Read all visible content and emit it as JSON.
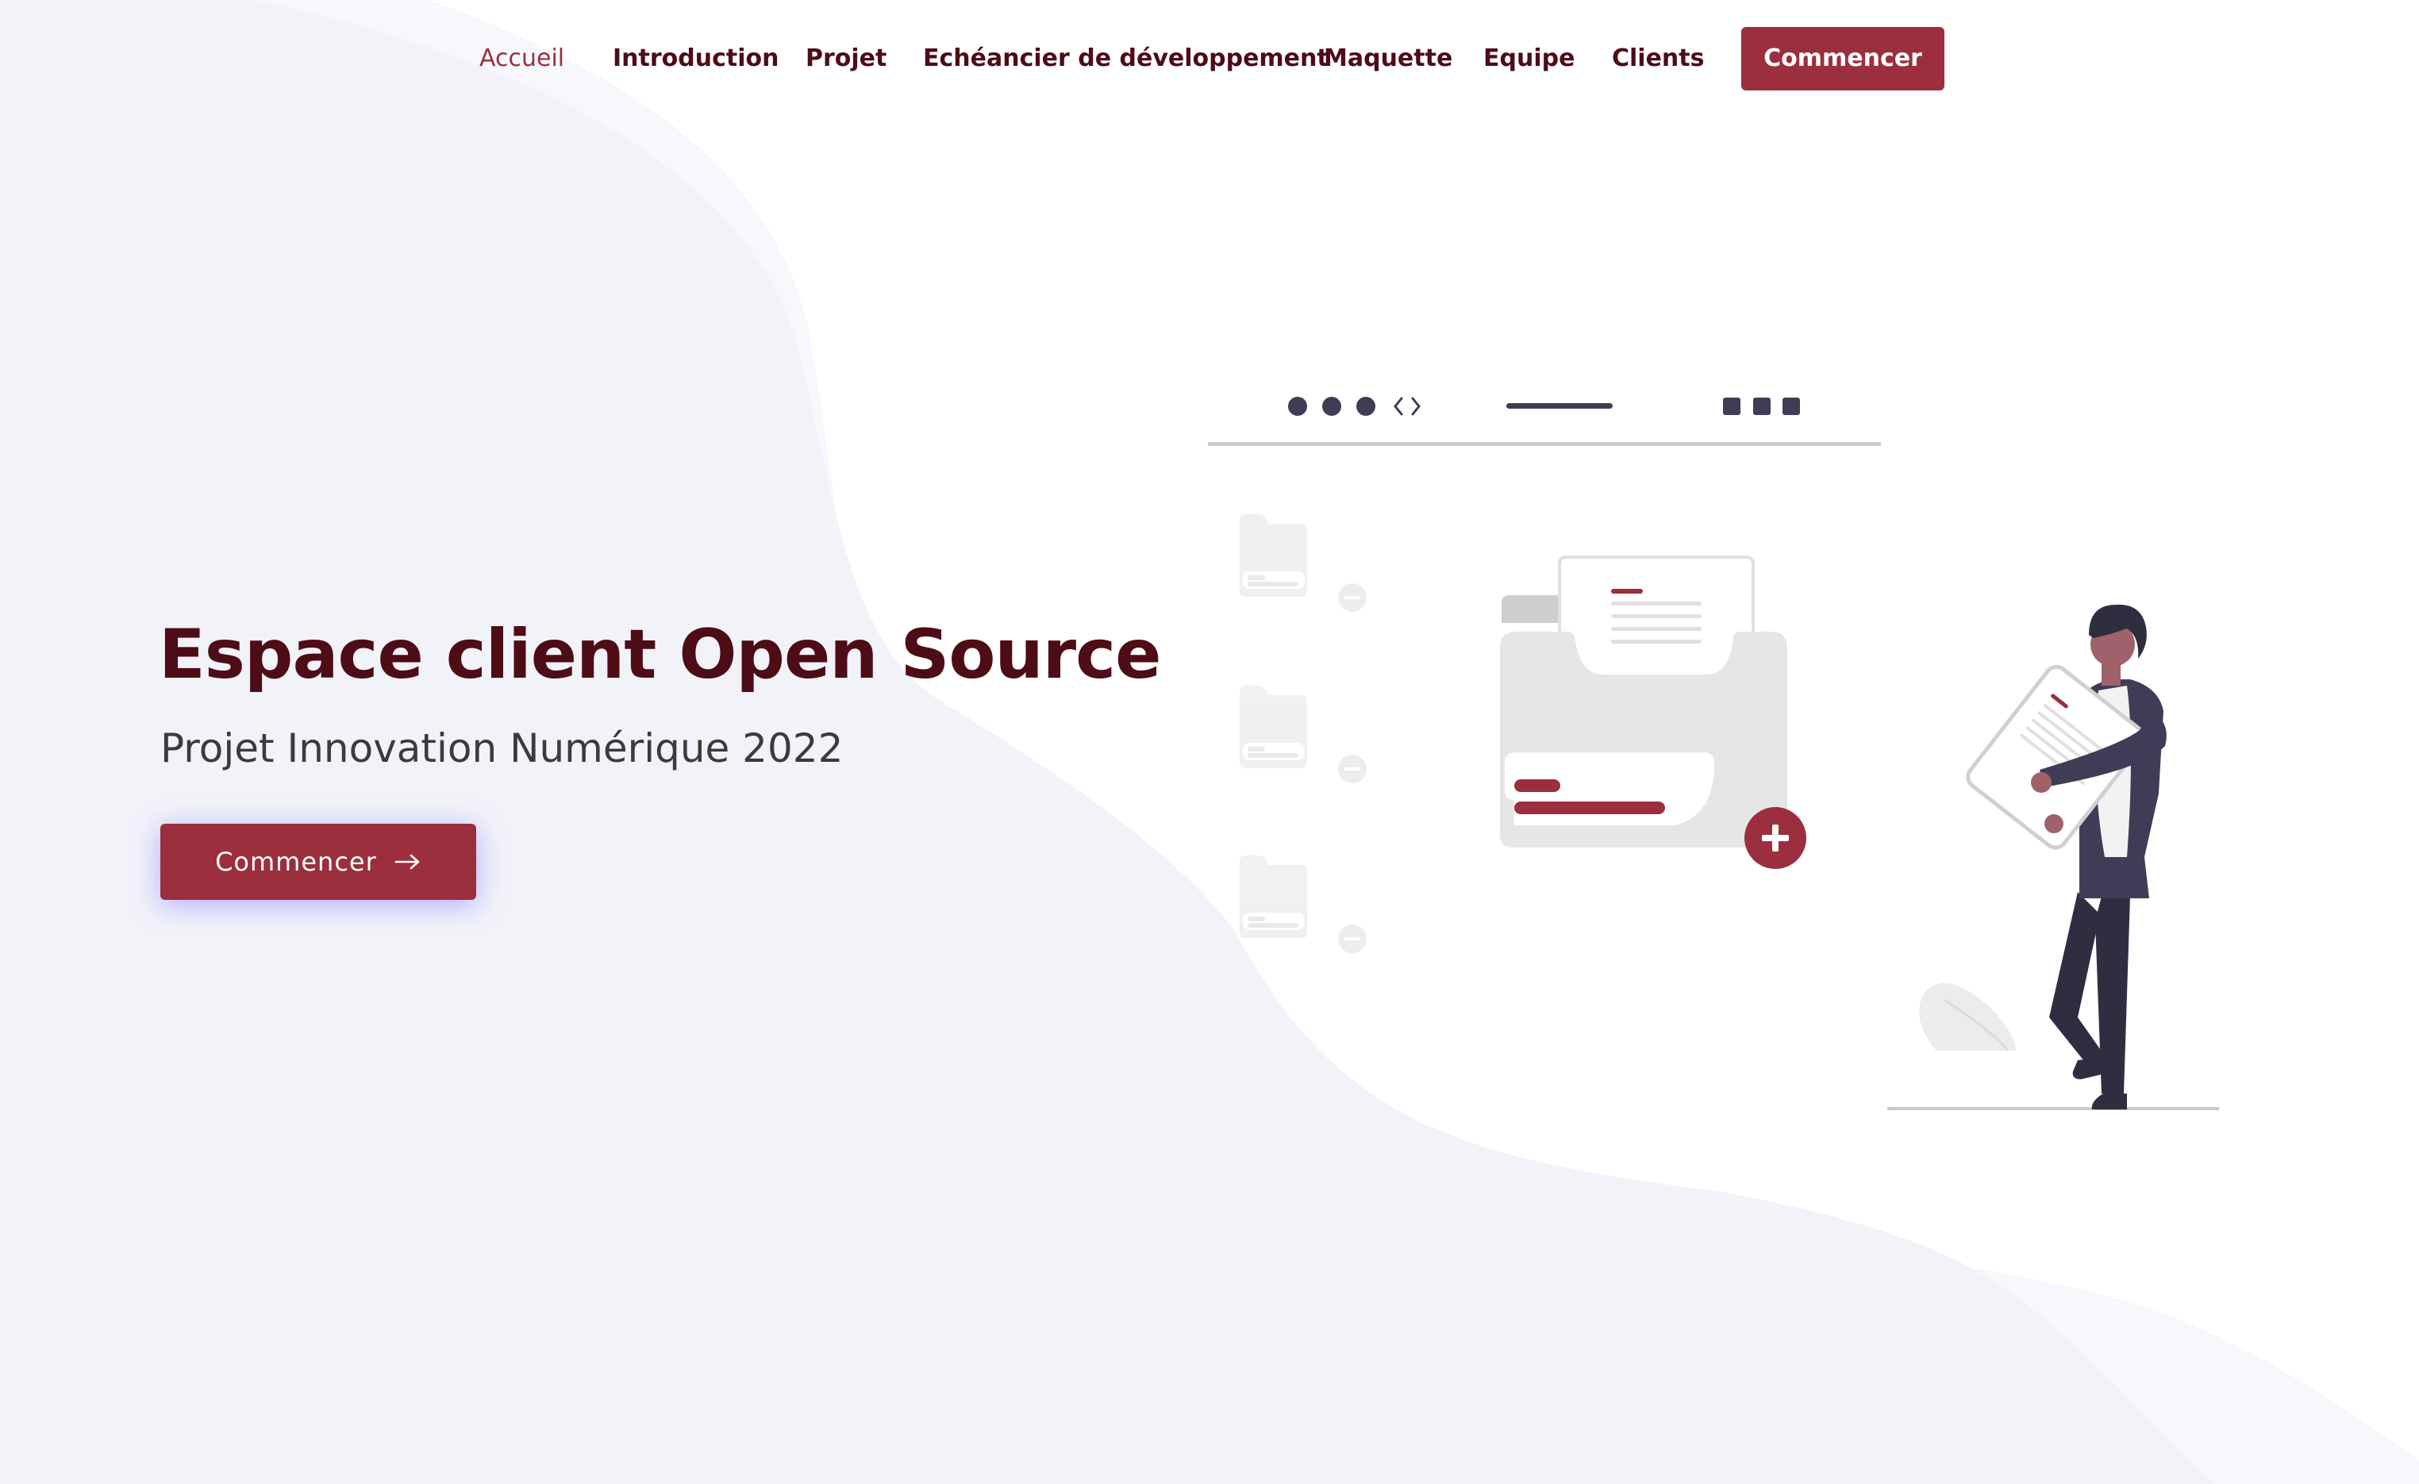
{
  "nav": {
    "items": [
      {
        "label": "Accueil",
        "active": true
      },
      {
        "label": "Introduction",
        "active": false
      },
      {
        "label": "Projet",
        "active": false
      },
      {
        "label": "Echéancier de développement",
        "active": false
      },
      {
        "label": "Maquette",
        "active": false
      },
      {
        "label": "Equipe",
        "active": false
      },
      {
        "label": "Clients",
        "active": false
      }
    ],
    "cta_label": "Commencer"
  },
  "hero": {
    "title": "Espace client Open Source",
    "subtitle": "Projet Innovation Numérique 2022",
    "cta_label": "Commencer",
    "cta_icon": "arrow-right-icon"
  },
  "illustration": {
    "icons": [
      "browser-dots-icon",
      "code-brackets-icon",
      "window-squares-icon",
      "folder-icon",
      "document-icon",
      "plus-circle-icon",
      "minus-circle-icon",
      "person-holding-document"
    ]
  },
  "colors": {
    "brand": "#9b2f3e",
    "heading": "#4e0c16",
    "text": "#3b3b3f",
    "nav_text": "#4e0c16",
    "wave_outer": "#f7f8fc",
    "wave_inner": "#f2f3f9",
    "illustration_dark": "#3f3d56",
    "illustration_light": "#e6e6e6"
  }
}
